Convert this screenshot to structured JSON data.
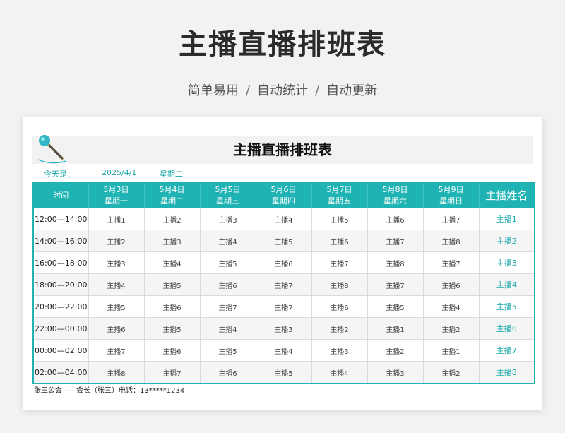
{
  "page_title": "主播直播排班表",
  "subtitle": [
    "简单易用",
    "自动统计",
    "自动更新"
  ],
  "subtitle_sep": "/",
  "sheet": {
    "title": "主播直播排班表",
    "today_label": "今天是：",
    "today_date": "2025/4/1",
    "today_weekday": "星期二",
    "headers": {
      "time": "时间",
      "days": [
        {
          "date": "5月3日",
          "weekday": "星期一"
        },
        {
          "date": "5月4日",
          "weekday": "星期二"
        },
        {
          "date": "5月5日",
          "weekday": "星期三"
        },
        {
          "date": "5月6日",
          "weekday": "星期四"
        },
        {
          "date": "5月7日",
          "weekday": "星期五"
        },
        {
          "date": "5月8日",
          "weekday": "星期六"
        },
        {
          "date": "5月9日",
          "weekday": "星期日"
        }
      ],
      "host_name": "主播姓名"
    },
    "rows": [
      {
        "time": "12:00—14:00",
        "cells": [
          "主播1",
          "主播2",
          "主播3",
          "主播4",
          "主播5",
          "主播6",
          "主播7"
        ],
        "host": "主播1"
      },
      {
        "time": "14:00—16:00",
        "cells": [
          "主播2",
          "主播3",
          "主播4",
          "主播5",
          "主播6",
          "主播7",
          "主播8"
        ],
        "host": "主播2"
      },
      {
        "time": "16:00—18:00",
        "cells": [
          "主播3",
          "主播4",
          "主播5",
          "主播6",
          "主播7",
          "主播8",
          "主播7"
        ],
        "host": "主播3"
      },
      {
        "time": "18:00—20:00",
        "cells": [
          "主播4",
          "主播5",
          "主播6",
          "主播7",
          "主播8",
          "主播7",
          "主播6"
        ],
        "host": "主播4"
      },
      {
        "time": "20:00—22:00",
        "cells": [
          "主播5",
          "主播6",
          "主播7",
          "主播7",
          "主播6",
          "主播5",
          "主播4"
        ],
        "host": "主播5"
      },
      {
        "time": "22:00—00:00",
        "cells": [
          "主播6",
          "主播5",
          "主播4",
          "主播3",
          "主播2",
          "主播1",
          "主播2"
        ],
        "host": "主播6"
      },
      {
        "time": "00:00—02:00",
        "cells": [
          "主播7",
          "主播6",
          "主播5",
          "主播4",
          "主播3",
          "主播2",
          "主播1"
        ],
        "host": "主播7"
      },
      {
        "time": "02:00—04:00",
        "cells": [
          "主播8",
          "主播7",
          "主播6",
          "主播5",
          "主播4",
          "主播3",
          "主播2"
        ],
        "host": "主播8"
      }
    ],
    "footer": "张三公会——会长（张三）电话：13*****1234"
  },
  "colors": {
    "accent": "#1fb3b3",
    "accent_text": "#1aa8a8"
  },
  "icons": {
    "banner": "microphone-icon"
  }
}
